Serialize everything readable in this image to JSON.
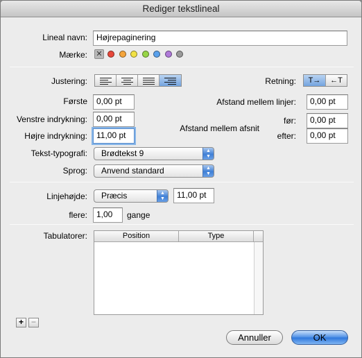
{
  "window": {
    "title": "Rediger tekstlineal"
  },
  "name": {
    "label": "Lineal navn:",
    "value": "Højrepaginering"
  },
  "mark": {
    "label": "Mærke:",
    "clear_symbol": "✕",
    "colors": [
      "#e8483a",
      "#f5a53c",
      "#f2e245",
      "#97d547",
      "#5aa1ec",
      "#b07ad9",
      "#9a9a9a"
    ]
  },
  "alignment": {
    "label": "Justering:",
    "selected": "right"
  },
  "direction": {
    "label": "Retning:",
    "ltr_symbol": "T→",
    "rtl_symbol": "←T"
  },
  "indent": {
    "first_label": "Første",
    "first_value": "0,00 pt",
    "left_label": "Venstre indrykning:",
    "left_value": "0,00 pt",
    "right_label": "Højre indrykning:",
    "right_value": "11,00 pt"
  },
  "spacing": {
    "lines_label": "Afstand mellem linjer:",
    "lines_value": "0,00 pt",
    "paragraph_label": "Afstand mellem afsnit",
    "before_label": "før:",
    "before_value": "0,00 pt",
    "after_label": "efter:",
    "after_value": "0,00 pt"
  },
  "text_style": {
    "label": "Tekst-typografi:",
    "value": "Brødtekst 9"
  },
  "language": {
    "label": "Sprog:",
    "value": "Anvend standard"
  },
  "line_height": {
    "label": "Linjehøjde:",
    "mode": "Præcis",
    "value": "11,00 pt",
    "multiple_label": "flere:",
    "multiple_value": "1,00",
    "multiple_suffix": "gange"
  },
  "tabs": {
    "label": "Tabulatorer:",
    "columns": [
      "Position",
      "Type"
    ],
    "add_symbol": "+",
    "remove_symbol": "−"
  },
  "buttons": {
    "cancel": "Annuller",
    "ok": "OK"
  }
}
